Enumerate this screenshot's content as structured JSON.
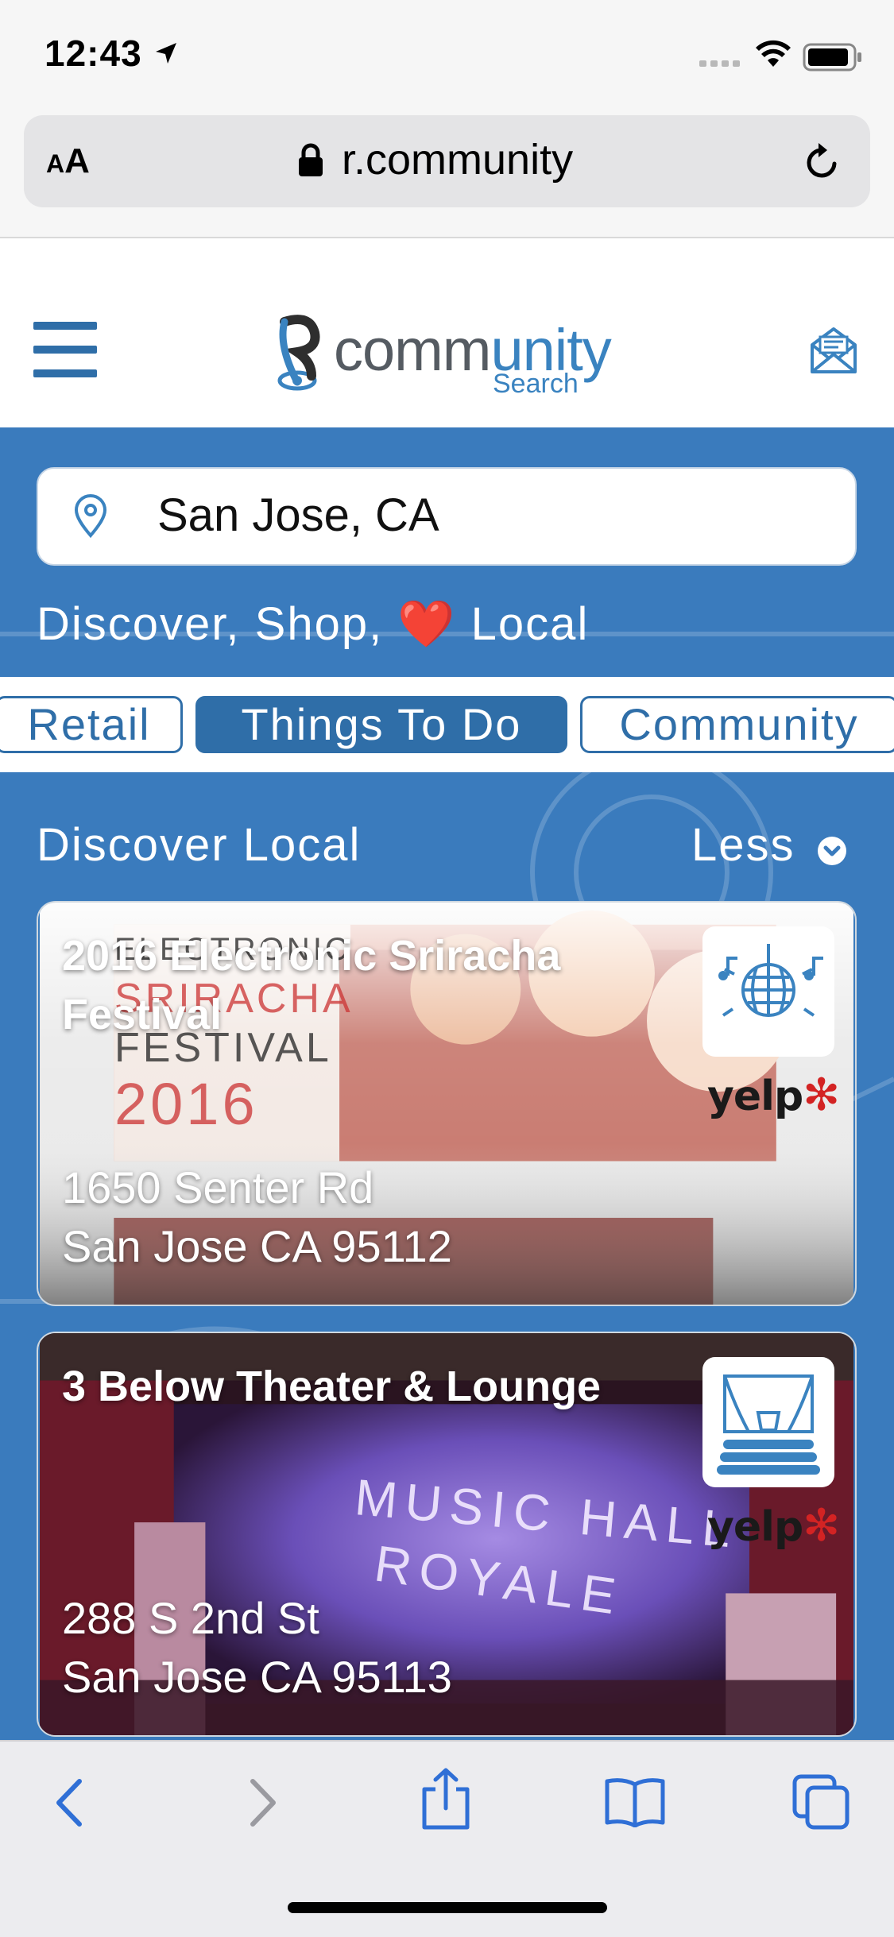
{
  "status_bar": {
    "time": "12:43"
  },
  "browser": {
    "aa_label_small": "A",
    "aa_label_big": "A",
    "url": "r.community"
  },
  "site": {
    "logo_word_start": "comm",
    "logo_word_end": "unity",
    "logo_sub": "Search"
  },
  "search": {
    "value": "San Jose, CA"
  },
  "tagline": {
    "before": "Discover, Shop,",
    "heart": "❤️",
    "after": "Local"
  },
  "tabs": [
    {
      "label": "Retail",
      "active": false
    },
    {
      "label": "Things To Do",
      "active": true
    },
    {
      "label": "Community",
      "active": false
    }
  ],
  "section": {
    "title": "Discover Local",
    "toggle_label": "Less"
  },
  "cards": [
    {
      "title": "2016 Electronic Sriracha Festival",
      "address_line1": "1650 Senter Rd",
      "address_line2": "San Jose CA 95112",
      "category_icon": "disco-music-icon",
      "source": "yelp",
      "image_text_1": "ELECTRONIC",
      "image_text_2": "SRIRACHA",
      "image_text_3": "FESTIVAL",
      "image_text_4": "2016"
    },
    {
      "title": "3 Below Theater & Lounge",
      "address_line1": "288 S 2nd St",
      "address_line2": "San Jose CA 95113",
      "category_icon": "theater-stage-icon",
      "source": "yelp",
      "image_text_1": "MUSIC HALL",
      "image_text_2": "ROYALE"
    }
  ],
  "colors": {
    "brand_blue": "#2f6ea8",
    "hero_blue": "#3a7bbd",
    "yelp_red": "#d32323"
  }
}
